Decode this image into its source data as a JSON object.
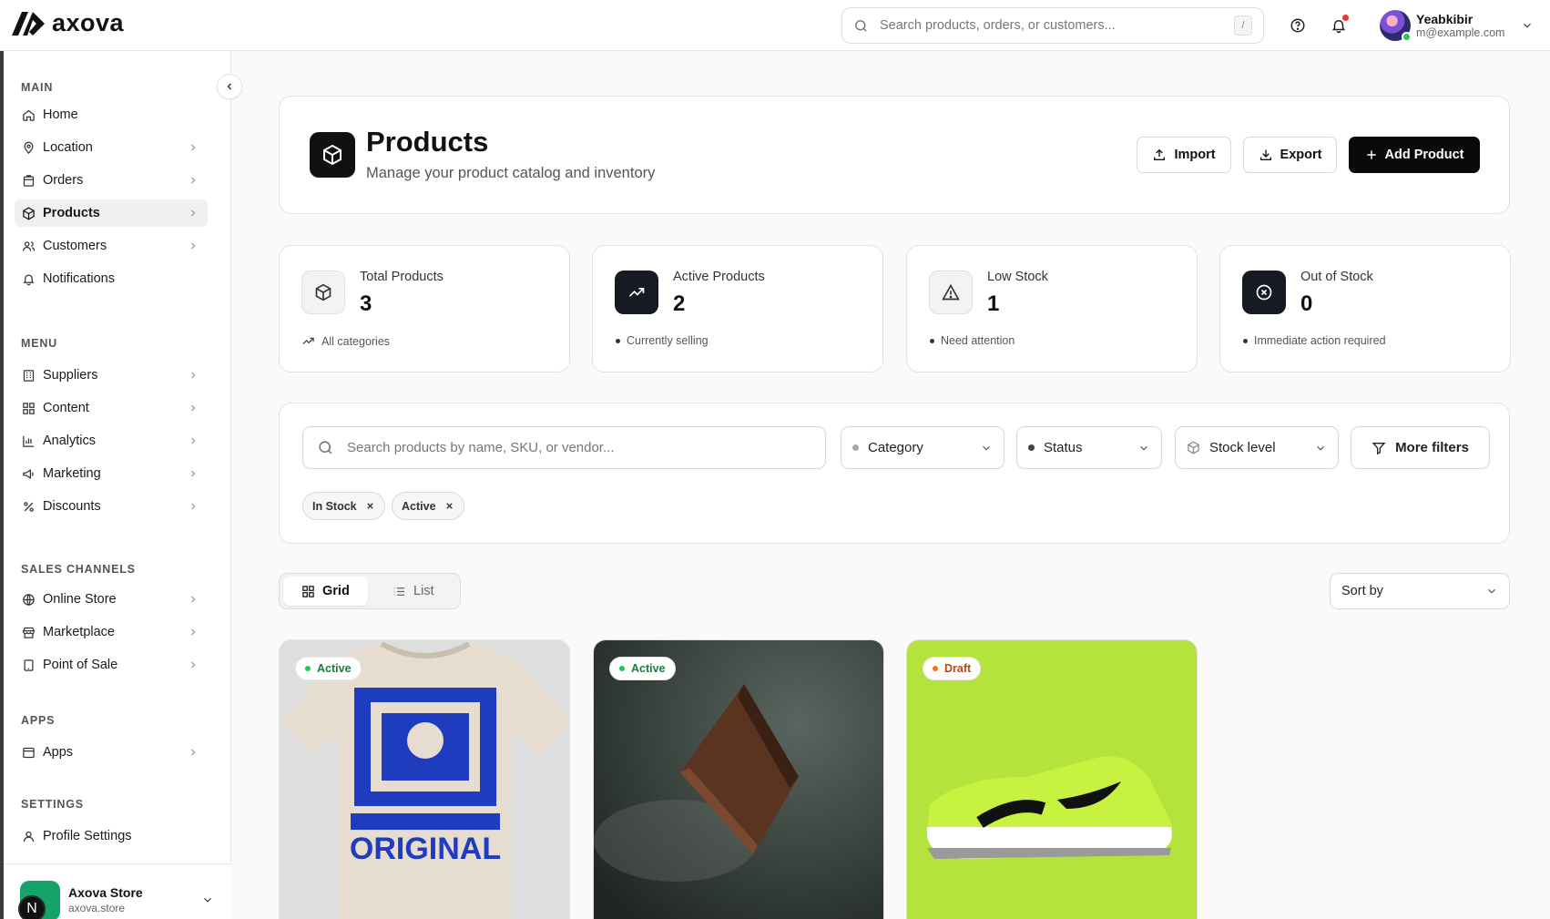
{
  "header": {
    "logo_text": "axova",
    "search_placeholder": "Search products, orders, or customers...",
    "search_shortcut": "/",
    "user_name": "Yeabkibir",
    "user_email": "m@example.com"
  },
  "sidebar": {
    "sections": {
      "main": "MAIN",
      "menu": "MENU",
      "sales_channels": "SALES CHANNELS",
      "apps": "APPS",
      "settings": "SETTINGS"
    },
    "items": {
      "home": "Home",
      "location": "Location",
      "orders": "Orders",
      "products": "Products",
      "customers": "Customers",
      "notifications": "Notifications",
      "suppliers": "Suppliers",
      "content": "Content",
      "analytics": "Analytics",
      "marketing": "Marketing",
      "discounts": "Discounts",
      "online_store": "Online Store",
      "marketplace": "Marketplace",
      "point_of_sale": "Point of Sale",
      "apps": "Apps",
      "profile_settings": "Profile Settings"
    },
    "active_item": "products",
    "store": {
      "name": "Axova Store",
      "url": "axova.store",
      "avatar_letter": "N"
    }
  },
  "page": {
    "title": "Products",
    "subtitle": "Manage your product catalog and inventory",
    "import_label": "Import",
    "export_label": "Export",
    "add_label": "Add Product"
  },
  "stats": [
    {
      "label": "Total Products",
      "value": "3",
      "foot": "All categories"
    },
    {
      "label": "Active Products",
      "value": "2",
      "foot": "Currently selling"
    },
    {
      "label": "Low Stock",
      "value": "1",
      "foot": "Need attention"
    },
    {
      "label": "Out of Stock",
      "value": "0",
      "foot": "Immediate action required"
    }
  ],
  "filters": {
    "search_placeholder": "Search products by name, SKU, or vendor...",
    "category": "Category",
    "status": "Status",
    "stock_level": "Stock level",
    "more_filters": "More filters",
    "chips": [
      "In Stock",
      "Active"
    ]
  },
  "view": {
    "grid_label": "Grid",
    "list_label": "List",
    "sort_label": "Sort by"
  },
  "products": [
    {
      "status": "Active",
      "image": "t-shirt-original-print",
      "bg": "#d8d8d8"
    },
    {
      "status": "Active",
      "image": "brown-leather-wallet",
      "bg": "#2f3834"
    },
    {
      "status": "Draft",
      "image": "neon-green-sneaker",
      "bg": "#b5e33d"
    }
  ],
  "colors": {
    "accent": "#0a0a0a",
    "active_green": "#15803d",
    "draft_orange": "#c2410c",
    "notif_red": "#e53935"
  }
}
